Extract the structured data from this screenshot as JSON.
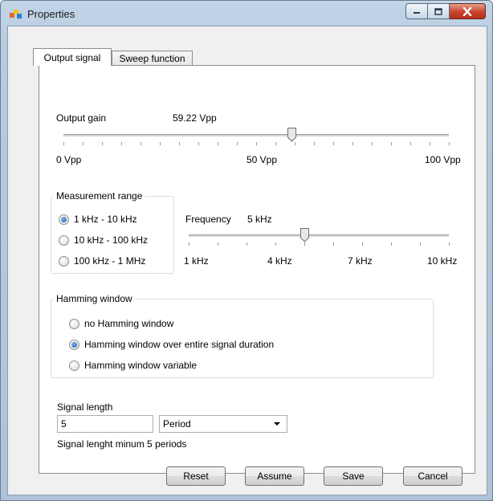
{
  "window": {
    "title": "Properties",
    "icon": "properties-app-icon"
  },
  "caption_buttons": {
    "minimize": "minimize-icon",
    "maximize": "maximize-icon",
    "close": "close-icon"
  },
  "tabs": [
    {
      "label": "Output signal",
      "active": true
    },
    {
      "label": "Sweep function",
      "active": false
    }
  ],
  "output_gain": {
    "label": "Output gain",
    "value_text": "59.22 Vpp",
    "value": 59.22,
    "min": 0,
    "max": 100,
    "min_label": "0 Vpp",
    "mid_label": "50 Vpp",
    "max_label": "100 Vpp"
  },
  "measurement_range": {
    "title": "Measurement range",
    "options": [
      {
        "label": "1 kHz - 10 kHz",
        "checked": true
      },
      {
        "label": "10 kHz - 100 kHz",
        "checked": false
      },
      {
        "label": "100 kHz - 1 MHz",
        "checked": false
      }
    ]
  },
  "frequency": {
    "label": "Frequency",
    "value_text": "5 kHz",
    "value": 5,
    "min": 1,
    "max": 10,
    "tick_labels": [
      "1 kHz",
      "4 kHz",
      "7 kHz",
      "10 kHz"
    ]
  },
  "hamming": {
    "title": "Hamming window",
    "options": [
      {
        "label": "no Hamming window",
        "checked": false
      },
      {
        "label": "Hamming window over entire signal duration",
        "checked": true
      },
      {
        "label": "Hamming window variable",
        "checked": false
      }
    ]
  },
  "signal_length": {
    "label": "Signal length",
    "value": "5",
    "unit": "Period",
    "hint": "Signal lenght minum 5 periods"
  },
  "buttons": {
    "reset": "Reset",
    "assume": "Assume",
    "save": "Save",
    "cancel": "Cancel"
  },
  "colors": {
    "radio_checked": "#1a5fb4",
    "close_button": "#c8432a",
    "title_bar": "#b7cbe0"
  }
}
